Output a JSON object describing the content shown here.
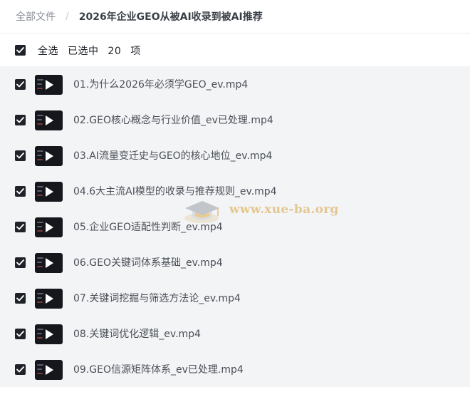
{
  "breadcrumb": {
    "root": "全部文件",
    "separator": "/",
    "current": "2026年企业GEO从被AI收录到被AI推荐"
  },
  "selection": {
    "select_all": "全选",
    "selected_prefix": "已选中",
    "count": "20",
    "suffix": "项",
    "all_checked": true
  },
  "files": [
    {
      "name": "01.为什么2026年必须学GEO_ev.mp4",
      "checked": true
    },
    {
      "name": "02.GEO核心概念与行业价值_ev已处理.mp4",
      "checked": true
    },
    {
      "name": "03.AI流量变迁史与GEO的核心地位_ev.mp4",
      "checked": true
    },
    {
      "name": "04.6大主流AI模型的收录与推荐规则_ev.mp4",
      "checked": true
    },
    {
      "name": "05.企业GEO适配性判断_ev.mp4",
      "checked": true
    },
    {
      "name": "06.GEO关键词体系基础_ev.mp4",
      "checked": true
    },
    {
      "name": "07.关键词挖掘与筛选方法论_ev.mp4",
      "checked": true
    },
    {
      "name": "08.关键词优化逻辑_ev.mp4",
      "checked": true
    },
    {
      "name": "09.GEO信源矩阵体系_ev已处理.mp4",
      "checked": true
    }
  ],
  "watermark": {
    "text": "www.xue-ba.org"
  },
  "colors": {
    "checkbox": "#1f2329",
    "list_background": "#f3f4f6",
    "watermark": "#e2bf7e"
  }
}
